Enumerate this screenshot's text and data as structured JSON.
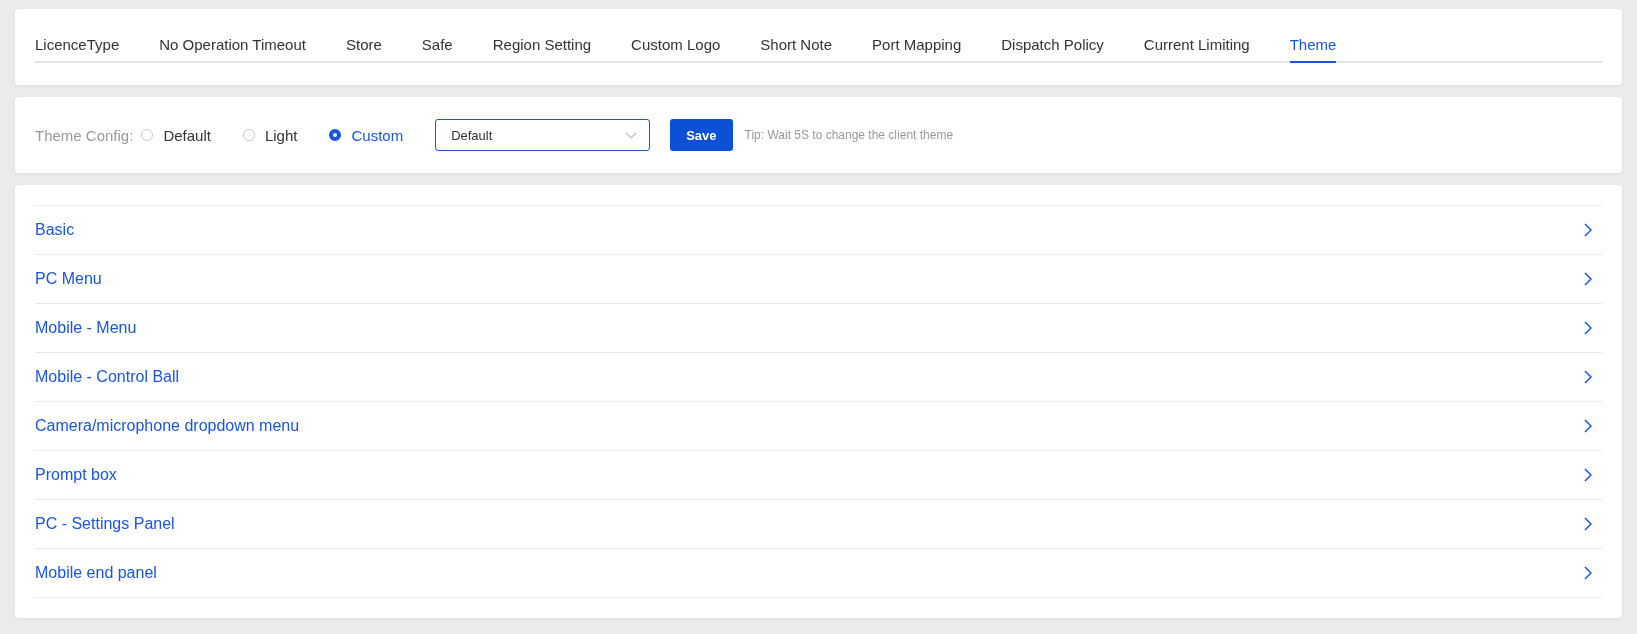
{
  "tabs": [
    {
      "label": "LicenceType",
      "selected": false
    },
    {
      "label": "No Operation Timeout",
      "selected": false
    },
    {
      "label": "Store",
      "selected": false
    },
    {
      "label": "Safe",
      "selected": false
    },
    {
      "label": "Region Setting",
      "selected": false
    },
    {
      "label": "Custom Logo",
      "selected": false
    },
    {
      "label": "Short Note",
      "selected": false
    },
    {
      "label": "Port Mapping",
      "selected": false
    },
    {
      "label": "Dispatch Policy",
      "selected": false
    },
    {
      "label": "Current Limiting",
      "selected": false
    },
    {
      "label": "Theme",
      "selected": true
    }
  ],
  "theme_config": {
    "label": "Theme Config:",
    "options": [
      {
        "label": "Default",
        "selected": false
      },
      {
        "label": "Light",
        "selected": false
      },
      {
        "label": "Custom",
        "selected": true
      }
    ],
    "select": {
      "value": "Default"
    },
    "save_button": "Save",
    "tip": "Tip: Wait 5S to change the client theme"
  },
  "sections": [
    {
      "label": "Basic"
    },
    {
      "label": "PC Menu"
    },
    {
      "label": "Mobile - Menu"
    },
    {
      "label": "Mobile - Control Ball"
    },
    {
      "label": "Camera/microphone dropdown menu"
    },
    {
      "label": "Prompt box"
    },
    {
      "label": "PC - Settings Panel"
    },
    {
      "label": "Mobile end panel"
    }
  ]
}
